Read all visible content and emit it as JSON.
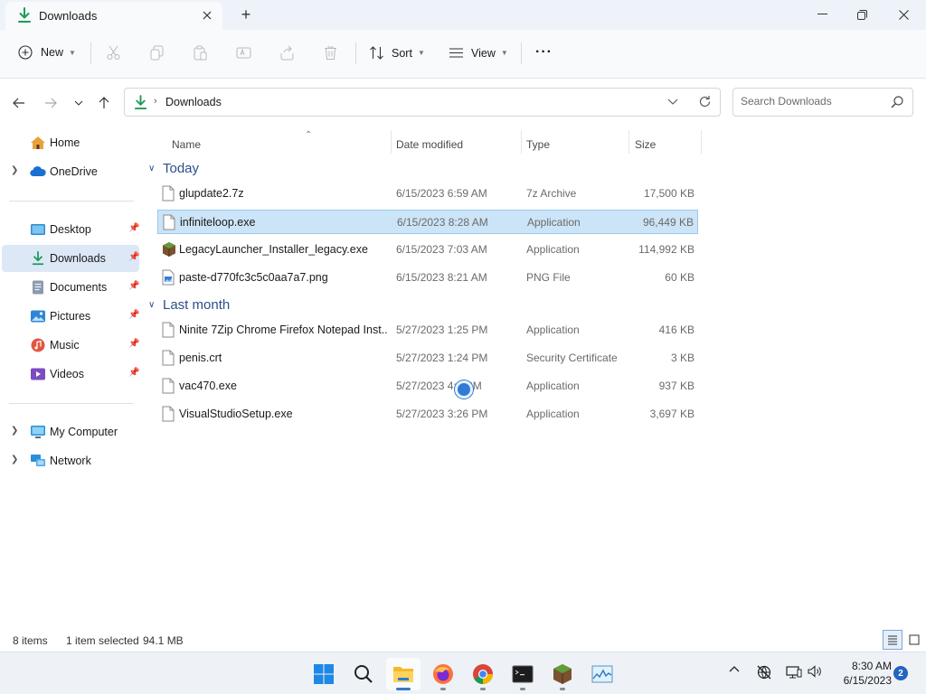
{
  "window": {
    "tab_title": "Downloads",
    "new_tab_label": "+"
  },
  "toolbar": {
    "new_label": "New",
    "sort_label": "Sort",
    "view_label": "View",
    "more_label": "···"
  },
  "address": {
    "breadcrumb": "Downloads",
    "search_placeholder": "Search Downloads"
  },
  "sidebar": {
    "items": [
      {
        "label": "Home",
        "icon": "home-icon"
      },
      {
        "label": "OneDrive",
        "icon": "onedrive-icon"
      },
      {
        "label": "Desktop",
        "icon": "desktop-icon"
      },
      {
        "label": "Downloads",
        "icon": "download-icon"
      },
      {
        "label": "Documents",
        "icon": "documents-icon"
      },
      {
        "label": "Pictures",
        "icon": "pictures-icon"
      },
      {
        "label": "Music",
        "icon": "music-icon"
      },
      {
        "label": "Videos",
        "icon": "videos-icon"
      },
      {
        "label": "My Computer",
        "icon": "computer-icon"
      },
      {
        "label": "Network",
        "icon": "network-icon"
      }
    ]
  },
  "columns": {
    "name": "Name",
    "date": "Date modified",
    "type": "Type",
    "size": "Size"
  },
  "groups": {
    "today": "Today",
    "last_month": "Last month"
  },
  "files": [
    {
      "name": "glupdate2.7z",
      "date": "6/15/2023 6:59 AM",
      "type": "7z Archive",
      "size": "17,500 KB"
    },
    {
      "name": "infiniteloop.exe",
      "date": "6/15/2023 8:28 AM",
      "type": "Application",
      "size": "96,449 KB"
    },
    {
      "name": "LegacyLauncher_Installer_legacy.exe",
      "date": "6/15/2023 7:03 AM",
      "type": "Application",
      "size": "114,992 KB"
    },
    {
      "name": "paste-d770fc3c5c0aa7a7.png",
      "date": "6/15/2023 8:21 AM",
      "type": "PNG File",
      "size": "60 KB"
    },
    {
      "name": "Ninite 7Zip Chrome Firefox Notepad Inst...",
      "date": "5/27/2023 1:25 PM",
      "type": "Application",
      "size": "416 KB"
    },
    {
      "name": "penis.crt",
      "date": "5/27/2023 1:24 PM",
      "type": "Security Certificate",
      "size": "3 KB"
    },
    {
      "name": "vac470.exe",
      "date": "5/27/2023 4:...PM",
      "type": "Application",
      "size": "937 KB"
    },
    {
      "name": "VisualStudioSetup.exe",
      "date": "5/27/2023 3:26 PM",
      "type": "Application",
      "size": "3,697 KB"
    }
  ],
  "status": {
    "item_count": "8 items",
    "selection": "1 item selected",
    "selection_size": "94.1 MB"
  },
  "taskbar": {
    "time": "8:30 AM",
    "date": "6/15/2023",
    "notifications": "2"
  },
  "colors": {
    "accent": "#3b78c4",
    "selection_bg": "#cce4f7",
    "group_header": "#2c4f8a"
  }
}
